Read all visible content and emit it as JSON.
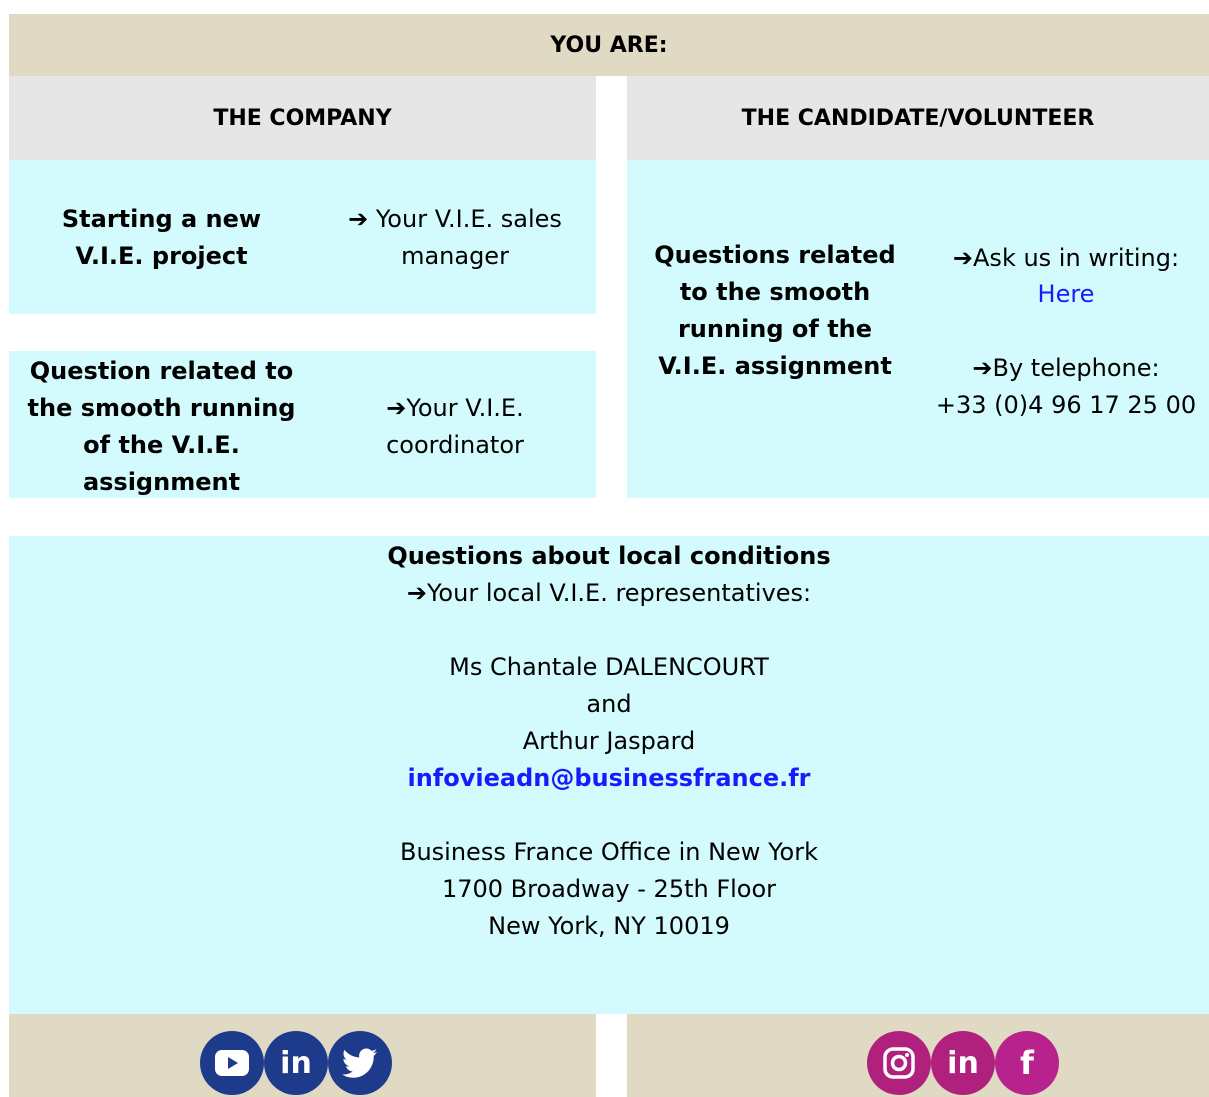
{
  "header": {
    "title": "YOU ARE:"
  },
  "company": {
    "title": "THE COMPANY",
    "row1": {
      "topic_line1": "Starting a new",
      "topic_line2": "V.I.E. project",
      "contact_arrow": "➔",
      "contact_line1": "Your V.I.E. sales",
      "contact_line2": "manager"
    },
    "row2": {
      "topic_line1": "Question related to",
      "topic_line2": "the smooth running",
      "topic_line3": "of the V.I.E.",
      "topic_line4": "assignment",
      "contact_arrow": "➔",
      "contact_line1": "Your V.I.E.",
      "contact_line2": "coordinator"
    }
  },
  "candidate": {
    "title": "THE CANDIDATE/VOLUNTEER",
    "topic_line1": "Questions related",
    "topic_line2": "to the smooth",
    "topic_line3": "running of the",
    "topic_line4": "V.I.E. assignment",
    "writing_arrow": "➔",
    "writing_label": "Ask us in writing:",
    "writing_link": "Here",
    "phone_arrow": "➔",
    "phone_label": "By telephone:",
    "phone_number": "+33 (0)4 96 17 25 00"
  },
  "local": {
    "title": "Questions about local conditions",
    "arrow": "➔",
    "subtitle": "Your local V.I.E. representatives:",
    "rep1": "Ms Chantale DALENCOURT",
    "and": "and",
    "rep2": "Arthur Jaspard",
    "email": "infovieadn@businessfrance.fr",
    "office_line1": "Business France Office in New York",
    "office_line2": "1700 Broadway - 25th Floor",
    "office_line3": "New York, NY 10019"
  },
  "social_left": {
    "icons": [
      "youtube-icon",
      "linkedin-icon",
      "twitter-icon"
    ],
    "color": "#1e3a8a",
    "linkedin_text": "in"
  },
  "social_right": {
    "icons": [
      "instagram-icon",
      "linkedin-icon",
      "facebook-icon"
    ],
    "color": "#b0217e",
    "linkedin_text": "in",
    "facebook_text": "f"
  }
}
